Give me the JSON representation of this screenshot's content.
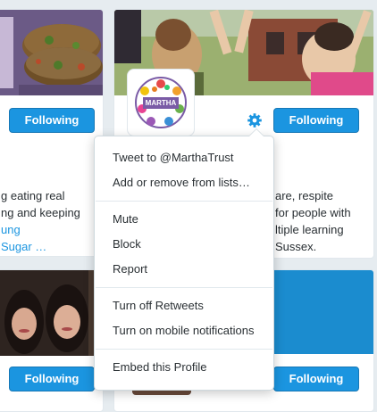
{
  "colors": {
    "accent": "#1b95e0",
    "text": "#292f33",
    "background": "#e6ecf0",
    "card_blue": "#1b8ccf"
  },
  "cards": {
    "top_left": {
      "follow_label": "Following",
      "bio_line1": "g eating real",
      "bio_line2": "ng and keeping",
      "bio_line3": "ung",
      "bio_line4": "Sugar …"
    },
    "top_right": {
      "follow_label": "Following",
      "bio_line1": "are, respite",
      "bio_line2": "for people with",
      "bio_line3": "ltiple learning",
      "bio_line4": "Sussex.",
      "gear_icon": "gear-icon",
      "logo_text": "MARTHA"
    },
    "bottom_left": {
      "follow_label": "Following"
    },
    "bottom_right": {
      "follow_label": "Following"
    }
  },
  "menu": {
    "items": [
      "Tweet to @MarthaTrust",
      "Add or remove from lists…",
      "Mute",
      "Block",
      "Report",
      "Turn off Retweets",
      "Turn on mobile notifications",
      "Embed this Profile"
    ]
  }
}
